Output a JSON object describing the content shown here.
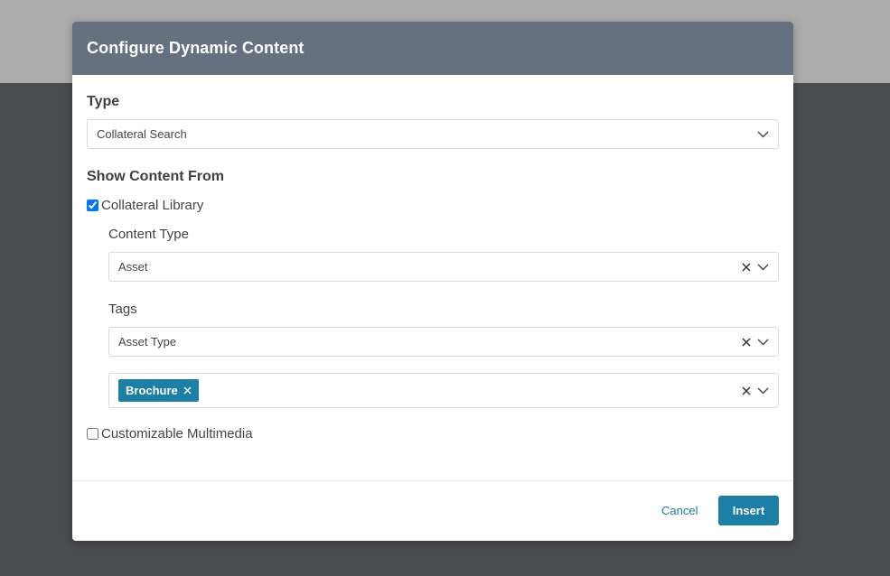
{
  "modal": {
    "title": "Configure Dynamic Content",
    "type_label": "Type",
    "type_value": "Collateral Search",
    "show_content_label": "Show Content From",
    "collateral_library": {
      "label": "Collateral Library",
      "checked": true
    },
    "content_type_label": "Content Type",
    "content_type_value": "Asset",
    "tags_label": "Tags",
    "tags_value": "Asset Type",
    "selected_tag": "Brochure",
    "customizable_multimedia": {
      "label": "Customizable Multimedia",
      "checked": false
    },
    "cancel_label": "Cancel",
    "insert_label": "Insert"
  },
  "colors": {
    "header_bg": "#65717f",
    "accent": "#1b7fa6",
    "overlay_dark": "#4a4b4f",
    "overlay_light": "#acacad"
  },
  "icons": {
    "dropdown": "chevron-down-icon",
    "clear": "close-icon",
    "chip_remove": "close-icon"
  }
}
